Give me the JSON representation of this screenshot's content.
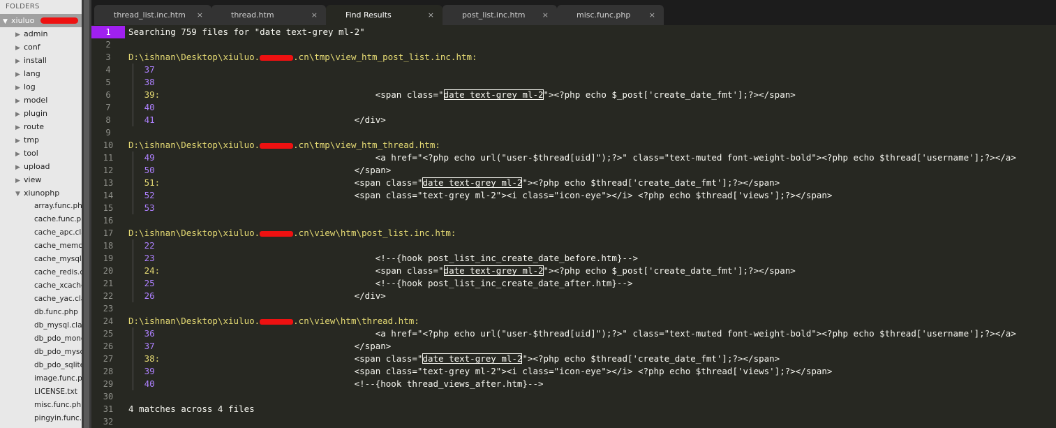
{
  "sidebar": {
    "heading": "FOLDERS",
    "root": "xiuluo",
    "folders": [
      "admin",
      "conf",
      "install",
      "lang",
      "log",
      "model",
      "plugin",
      "route",
      "tmp",
      "tool",
      "upload",
      "view"
    ],
    "open_folder": "xiunophp",
    "files": [
      "array.func.php",
      "cache.func.php",
      "cache_apc.class.php",
      "cache_memcache.class.php",
      "cache_mysql.class.php",
      "cache_redis.class.php",
      "cache_xcache.class.php",
      "cache_yac.class.php",
      "db.func.php",
      "db_mysql.class.php",
      "db_pdo_mongodb.class.php",
      "db_pdo_mysql.class.php",
      "db_pdo_sqlite.class.php",
      "image.func.php",
      "LICENSE.txt",
      "misc.func.php",
      "pingyin.func.php"
    ]
  },
  "tabs": [
    {
      "label": "thread_list.inc.htm",
      "close": "×"
    },
    {
      "label": "thread.htm",
      "close": "×"
    },
    {
      "label": "Find Results",
      "close": "×"
    },
    {
      "label": "post_list.inc.htm",
      "close": "×"
    },
    {
      "label": "misc.func.php",
      "close": "×"
    }
  ],
  "editor": {
    "lines": [
      {
        "n": "1",
        "text": "Searching 759 files for \"date text-grey ml-2\""
      },
      {
        "n": "2",
        "text": ""
      },
      {
        "n": "3",
        "path_pre": "D:\\ishnan\\Desktop\\xiuluo.",
        "path_post": ".cn\\tmp\\view_htm_post_list.inc.htm:"
      },
      {
        "n": "4",
        "ln": "37",
        "text": ""
      },
      {
        "n": "5",
        "ln": "38",
        "text": ""
      },
      {
        "n": "6",
        "ln": "39:",
        "match": true,
        "indent": "                                        ",
        "pre": "<span class=\"",
        "hl": "date text-grey ml-2",
        "post": "\"><?php echo $_post['create_date_fmt'];?></span>"
      },
      {
        "n": "7",
        "ln": "40",
        "text": ""
      },
      {
        "n": "8",
        "ln": "41",
        "indent": "                                    ",
        "text": "</div>"
      },
      {
        "n": "9",
        "text": ""
      },
      {
        "n": "10",
        "path_pre": "D:\\ishnan\\Desktop\\xiuluo.",
        "path_post": ".cn\\tmp\\view_htm_thread.htm:"
      },
      {
        "n": "11",
        "ln": "49",
        "indent": "                                        ",
        "text": "<a href=\"<?php echo url(\"user-$thread[uid]\");?>\" class=\"text-muted font-weight-bold\"><?php echo $thread['username'];?></a>"
      },
      {
        "n": "12",
        "ln": "50",
        "indent": "                                    ",
        "text": "</span>"
      },
      {
        "n": "13",
        "ln": "51:",
        "match": true,
        "indent": "                                    ",
        "pre": "<span class=\"",
        "hl": "date text-grey ml-2",
        "post": "\"><?php echo $thread['create_date_fmt'];?></span>"
      },
      {
        "n": "14",
        "ln": "52",
        "indent": "                                    ",
        "text": "<span class=\"text-grey ml-2\"><i class=\"icon-eye\"></i> <?php echo $thread['views'];?></span>"
      },
      {
        "n": "15",
        "ln": "53",
        "text": ""
      },
      {
        "n": "16",
        "text": ""
      },
      {
        "n": "17",
        "path_pre": "D:\\ishnan\\Desktop\\xiuluo.",
        "path_post": ".cn\\view\\htm\\post_list.inc.htm:"
      },
      {
        "n": "18",
        "ln": "22",
        "text": ""
      },
      {
        "n": "19",
        "ln": "23",
        "indent": "                                        ",
        "text": "<!--{hook post_list_inc_create_date_before.htm}-->"
      },
      {
        "n": "20",
        "ln": "24:",
        "match": true,
        "indent": "                                        ",
        "pre": "<span class=\"",
        "hl": "date text-grey ml-2",
        "post": "\"><?php echo $_post['create_date_fmt'];?></span>"
      },
      {
        "n": "21",
        "ln": "25",
        "indent": "                                        ",
        "text": "<!--{hook post_list_inc_create_date_after.htm}-->"
      },
      {
        "n": "22",
        "ln": "26",
        "indent": "                                    ",
        "text": "</div>"
      },
      {
        "n": "23",
        "text": ""
      },
      {
        "n": "24",
        "path_pre": "D:\\ishnan\\Desktop\\xiuluo.",
        "path_post": ".cn\\view\\htm\\thread.htm:"
      },
      {
        "n": "25",
        "ln": "36",
        "indent": "                                        ",
        "text": "<a href=\"<?php echo url(\"user-$thread[uid]\");?>\" class=\"text-muted font-weight-bold\"><?php echo $thread['username'];?></a>"
      },
      {
        "n": "26",
        "ln": "37",
        "indent": "                                    ",
        "text": "</span>"
      },
      {
        "n": "27",
        "ln": "38:",
        "match": true,
        "indent": "                                    ",
        "pre": "<span class=\"",
        "hl": "date text-grey ml-2",
        "post": "\"><?php echo $thread['create_date_fmt'];?></span>"
      },
      {
        "n": "28",
        "ln": "39",
        "indent": "                                    ",
        "text": "<span class=\"text-grey ml-2\"><i class=\"icon-eye\"></i> <?php echo $thread['views'];?></span>"
      },
      {
        "n": "29",
        "ln": "40",
        "indent": "                                    ",
        "text": "<!--{hook thread_views_after.htm}-->"
      },
      {
        "n": "30",
        "text": ""
      },
      {
        "n": "31",
        "text": "4 matches across 4 files"
      },
      {
        "n": "32",
        "text": ""
      }
    ]
  }
}
